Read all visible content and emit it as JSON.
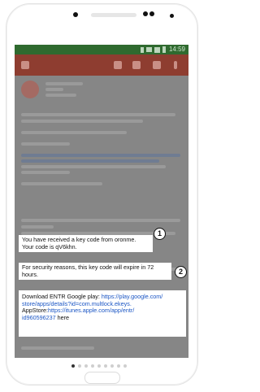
{
  "status": {
    "time": "14:59"
  },
  "callouts": [
    {
      "badge": "1",
      "lines": [
        "You have received a key code from oronme.",
        "Your code is qV6khn."
      ]
    },
    {
      "badge": "2",
      "lines": [
        "For security reasons, this key code will expire in 72",
        "hours."
      ]
    },
    {
      "google_prefix": "Download ENTR Google play: ",
      "google_url_1": "https://play.google.com/",
      "google_url_2": "store/apps/details?id=com.multlock.ekeys.",
      "apple_prefix": "AppStore:",
      "apple_url_1": "https://itunes.apple.com/app/entr/",
      "apple_url_2": "id960596237",
      "apple_suffix": " here"
    }
  ],
  "pager": {
    "count": 9,
    "active_index": 0
  }
}
